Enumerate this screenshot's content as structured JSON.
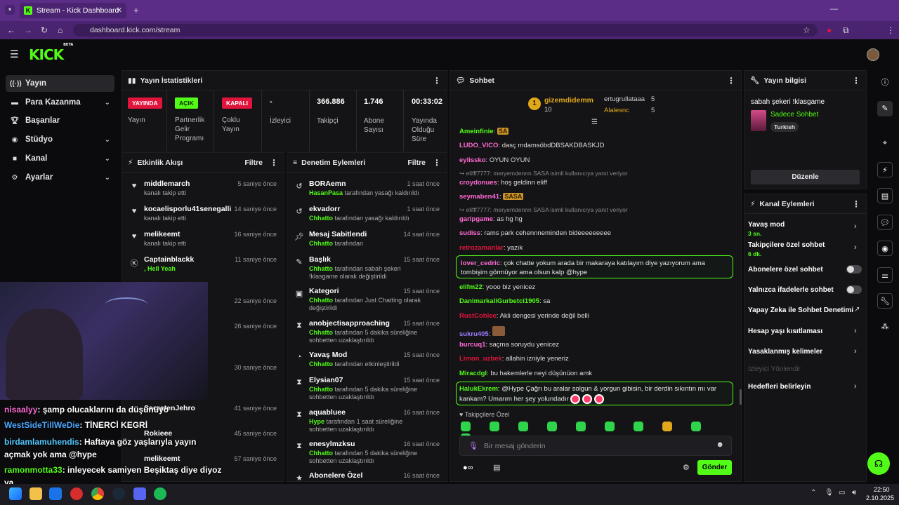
{
  "browser": {
    "tab_title": "Stream - Kick Dashboard",
    "url": "dashboard.kick.com/stream"
  },
  "logo": {
    "text": "KICK",
    "beta": "BETA"
  },
  "sidebar": {
    "items": [
      {
        "label": "Yayın",
        "icon": "broadcast-icon",
        "active": true
      },
      {
        "label": "Para Kazanma",
        "icon": "money-icon"
      },
      {
        "label": "Başarılar",
        "icon": "trophy-icon"
      },
      {
        "label": "Stüdyo",
        "icon": "studio-icon"
      },
      {
        "label": "Kanal",
        "icon": "channel-icon"
      },
      {
        "label": "Ayarlar",
        "icon": "gear-icon"
      }
    ]
  },
  "stats": {
    "title": "Yayın İstatistikleri",
    "items": [
      {
        "badge": "YAYINDA",
        "label": "Yayın",
        "color": "#e0143c"
      },
      {
        "badge": "AÇIK",
        "label": "Partnerlik Gelir Programı",
        "color": "#53fc18"
      },
      {
        "badge": "KAPALI",
        "label": "Çoklu Yayın",
        "color": "#e0143c"
      },
      {
        "value": "-",
        "label": "İzleyici"
      },
      {
        "value": "366.886",
        "label": "Takipçi"
      },
      {
        "value": "1.746",
        "label": "Abone Sayısı"
      },
      {
        "value": "00:33:02",
        "label": "Yayında Olduğu Süre"
      }
    ]
  },
  "activity": {
    "title": "Etkinlik Akışı",
    "filter": "Filtre",
    "items": [
      {
        "name": "middlemarch",
        "sub": "kanalı takip etti",
        "time": "5 saniye önce"
      },
      {
        "name": "kocaelisporlu41senegalli",
        "sub": "kanalı takip etti",
        "time": "14 saniye önce"
      },
      {
        "name": "melikeemt",
        "sub": "kanalı takip etti",
        "time": "16 saniye önce"
      },
      {
        "name": "Captainblackk",
        "sub": ", Hell Yeah",
        "time": "11 saniye önce"
      },
      {
        "time": "22 saniye önce"
      },
      {
        "time": "26 saniye önce"
      },
      {
        "time": "30 saniye önce"
      },
      {
        "name": "SecretenJehro",
        "time": "41 saniye önce"
      },
      {
        "name": "Rokieee",
        "time": "45 saniye önce"
      },
      {
        "name": "melikeemt",
        "time": "57 saniye önce"
      }
    ]
  },
  "moderation": {
    "title": "Denetim Eylemleri",
    "filter": "Filtre",
    "items": [
      {
        "name": "BORAemn",
        "actor": "HasanPasa",
        "sub": "tarafından yasağı kaldırıldı",
        "time": "1 saat önce"
      },
      {
        "name": "ekvadorr",
        "actor": "Chhatto",
        "sub": "tarafından yasağı kaldırıldı",
        "time": "1 saat önce"
      },
      {
        "name": "Mesaj Sabitlendi",
        "actor": "Chhatto",
        "sub": "tarafından",
        "time": "14 saat önce"
      },
      {
        "name": "Başlık",
        "actor": "Chhatto",
        "sub": "tarafından sabah şekeri !klasgame olarak değiştirildi",
        "time": "15 saat önce"
      },
      {
        "name": "Kategori",
        "actor": "Chhatto",
        "sub": "tarafından Just Chatting olarak değiştirildi",
        "time": "15 saat önce"
      },
      {
        "name": "anobjectisapproaching",
        "actor": "Chhatto",
        "sub": "tarafından 5 dakika süreliğine sohbetten uzaklaştırıldı",
        "time": "15 saat önce"
      },
      {
        "name": "Yavaş Mod",
        "actor": "Chhatto",
        "sub": "tarafından etkinleştirildi",
        "time": "15 saat önce"
      },
      {
        "name": "Elysian07",
        "actor": "Chhatto",
        "sub": "tarafından 5 dakika süreliğine sohbetten uzaklaştırıldı",
        "time": "15 saat önce"
      },
      {
        "name": "aquabluee",
        "actor": "Hype",
        "sub": "tarafından 1 saat süreliğine sohbetten uzaklaştırıldı",
        "time": "16 saat önce"
      },
      {
        "name": "enesylmzksu",
        "actor": "Chhatto",
        "sub": "tarafından 5 dakika süreliğine sohbetten uzaklaştırıldı",
        "time": "16 saat önce"
      },
      {
        "name": "Abonelere Özel",
        "time": "16 saat önce"
      }
    ]
  },
  "chat": {
    "title": "Sohbet",
    "top_gifter": {
      "name": "gizemdidemm",
      "count": "10",
      "rank": "1"
    },
    "gifters": [
      {
        "name": "ertugrullataaa",
        "count": "5"
      },
      {
        "name": "Alalesnc",
        "count": "5"
      }
    ],
    "messages": [
      {
        "user": "Ameinfinie",
        "text": "SA",
        "color": "#53fc18"
      },
      {
        "user": "LUDO_VICO",
        "text": "dasç mdamsöbdDBSAKDBASKJD",
        "color": "#ff6ad5"
      },
      {
        "user": "eylissko",
        "text": "OYUN OYUN",
        "color": "#ff6ad5"
      },
      {
        "reply": "elifff7777: meryemdennn SASA isimli kullanıcıya yanıt veriyor"
      },
      {
        "user": "croydonues",
        "text": "hoş geldinn eliff",
        "color": "#ff6ad5"
      },
      {
        "user": "seymaben41",
        "text": "SASA",
        "color": "#ff6ad5"
      },
      {
        "reply": "elifff7777: meryemdennn SASA isimli kullanıcıya yanıt veriyor"
      },
      {
        "user": "garipgame",
        "text": "as hg hg",
        "color": "#ff6ad5"
      },
      {
        "user": "sudiss",
        "text": "rams park cehennneminden bideeeeeeeee",
        "color": "#ff6ad5"
      },
      {
        "user": "retrozamanlar",
        "text": "yazık",
        "color": "#e0143c"
      },
      {
        "user": "lover_cedric",
        "text": "çok chatte yokum arada bir makaraya katılayım diye yazıyorum ama tombişim görmüyor ama olsun kalp @hype",
        "color": "#ff6ad5"
      },
      {
        "user": "elifm22",
        "text": "yooo biz yenicez",
        "color": "#53fc18"
      },
      {
        "user": "DanimarkaliGurbetci1905",
        "text": "sa",
        "color": "#53fc18"
      },
      {
        "user": "RustCohlee",
        "text": "Akli dengesi yerinde değil belli",
        "color": "#e0143c"
      },
      {
        "user": "sukru405",
        "text": "",
        "color": "#9b7bff"
      },
      {
        "user": "burcuq1",
        "text": "saçma soruydu yenicez",
        "color": "#ff6ad5"
      },
      {
        "user": "Limon_uzbek",
        "text": "allahin izniyle yeneriz",
        "color": "#e0143c"
      },
      {
        "user": "Miracdgl",
        "text": "bu hakemlerle neyi düşünüon amk",
        "color": "#53fc18"
      },
      {
        "user": "HalukEkrem",
        "text": "@Hype Çağrı bu aralar solgun & yorgun gibisin, bir derdin sıkıntın mı var kankam? Umarım her şey yolundadır",
        "color": "#53fc18"
      }
    ],
    "followers_only": "Takipçilere Özel",
    "placeholder": "Bir mesaj gönderin",
    "send": "Gönder"
  },
  "stream_info": {
    "title": "Yayın bilgisi",
    "stream_title": "sabah şekeri !klasgame",
    "category": "Sadece Sohbet",
    "tag": "Turkish",
    "edit": "Düzenle"
  },
  "channel_actions": {
    "title": "Kanal Eylemleri",
    "items": [
      {
        "label": "Yavaş mod",
        "sub": "3 sn."
      },
      {
        "label": "Takipçilere özel sohbet",
        "sub": "6 dk."
      },
      {
        "label": "Abonelere özel sohbet"
      },
      {
        "label": "Yalnızca ifadelerle sohbet"
      },
      {
        "label": "Yapay Zeka ile Sohbet Denetimi"
      },
      {
        "label": "Hesap yaşı kısıtlaması"
      },
      {
        "label": "Yasaklanmış kelimeler"
      },
      {
        "label": "İzleyici Yönlendir"
      },
      {
        "label": "Hedefleri belirleyin"
      }
    ]
  },
  "overlay_chat": [
    {
      "user": "nisaalyy",
      "text": ": şamp olucaklarını da düşünüyo",
      "color": "#ff6ad5"
    },
    {
      "user": "WestSideTillWeDie",
      "text": ": TİNERCİ KEGRİ",
      "color": "#4aa8ff"
    },
    {
      "user": "birdamlamuhendis",
      "text": ": Haftaya göz yaşlarıyla yayın açmak yok ama @hype",
      "color": "#53c8ff"
    },
    {
      "user": "ramonmotta33",
      "text": ": inleyecek samiyen Beşiktaş diye diyoz ya",
      "color": "#53fc18"
    }
  ],
  "taskbar": {
    "time": "22:50",
    "date": "2.10.2025"
  }
}
